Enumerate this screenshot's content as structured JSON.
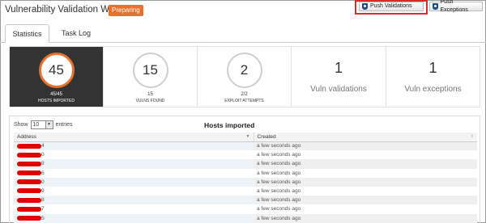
{
  "header": {
    "title": "Vulnerability Validation Wizard",
    "status_badge": "Preparing",
    "accent_color": "#e8722c"
  },
  "actions": {
    "push_validations": {
      "label": "Push Validations",
      "icon": "shield-icon"
    },
    "push_exceptions": {
      "label": "Push Exceptions",
      "icon": "shield-icon"
    },
    "highlight_color": "#d92b2b"
  },
  "tabs": [
    {
      "label": "Statistics",
      "active": true
    },
    {
      "label": "Task Log",
      "active": false
    }
  ],
  "stats": [
    {
      "value": "45",
      "sub": "45/45",
      "caption": "HOSTS IMPORTED"
    },
    {
      "value": "15",
      "sub": "15",
      "caption": "VULNS FOUND"
    },
    {
      "value": "2",
      "sub": "2/2",
      "caption": "EXPLOIT ATTEMPTS"
    },
    {
      "value": "1",
      "label": "Vuln validations"
    },
    {
      "value": "1",
      "label": "Vuln exceptions"
    }
  ],
  "table": {
    "show_label": "Show",
    "page_size": "10",
    "entries_label": "entries",
    "title": "Hosts imported",
    "columns": [
      "Address",
      "Created"
    ],
    "rows": [
      {
        "address_tail": "4",
        "created": "a few seconds ago"
      },
      {
        "address_tail": "0",
        "created": "a few seconds ago"
      },
      {
        "address_tail": "9",
        "created": "a few seconds ago"
      },
      {
        "address_tail": "6",
        "created": "a few seconds ago"
      },
      {
        "address_tail": "0",
        "created": "a few seconds ago"
      },
      {
        "address_tail": "9",
        "created": "a few seconds ago"
      },
      {
        "address_tail": "8",
        "created": "a few seconds ago"
      },
      {
        "address_tail": "7",
        "created": "a few seconds ago"
      },
      {
        "address_tail": "5",
        "created": "a few seconds ago"
      }
    ]
  }
}
